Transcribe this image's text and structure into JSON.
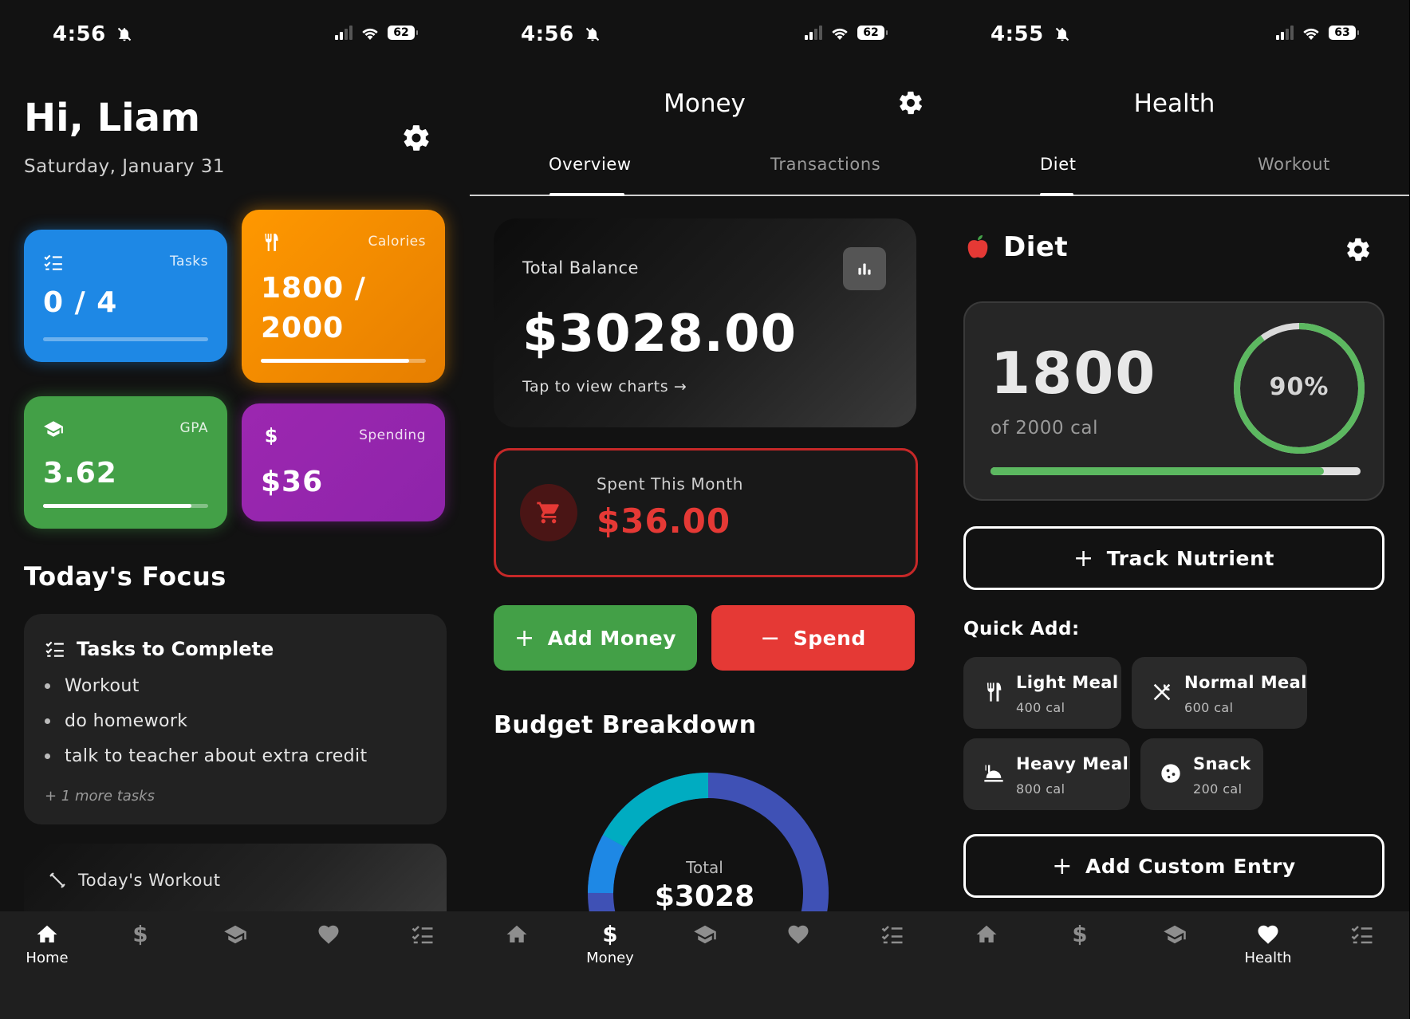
{
  "screens": [
    {
      "status": {
        "time": "4:56",
        "battery": "62"
      },
      "greeting": "Hi, Liam",
      "date": "Saturday, January 31",
      "tiles": [
        {
          "label": "Tasks",
          "value": "0 / 4",
          "progress": 1.0,
          "color": "#1e88e5"
        },
        {
          "label": "Calories",
          "value": "1800 /",
          "value2": "2000",
          "progress": 0.9,
          "color": "#f08a00"
        },
        {
          "label": "GPA",
          "value": "3.62",
          "progress": 0.9,
          "color": "#43a047"
        },
        {
          "label": "Spending",
          "value": "$36",
          "color": "#9c27b0"
        }
      ],
      "focus_title": "Today's Focus",
      "tasks_card": {
        "title": "Tasks to Complete",
        "items": [
          "Workout",
          "do homework",
          "talk to teacher about extra credit"
        ],
        "more": "+ 1 more tasks"
      },
      "workout_card": {
        "title": "Today's Workout"
      },
      "nav_label": "Home"
    },
    {
      "status": {
        "time": "4:56",
        "battery": "62"
      },
      "title": "Money",
      "tabs": [
        "Overview",
        "Transactions"
      ],
      "balance": {
        "label": "Total Balance",
        "value": "$3028.00",
        "hint": "Tap to view charts →"
      },
      "spent": {
        "label": "Spent This Month",
        "value": "$36.00"
      },
      "add_money": "Add Money",
      "spend": "Spend",
      "budget_title": "Budget Breakdown",
      "donut": {
        "label": "Total",
        "value": "$3028"
      },
      "nav_label": "Money"
    },
    {
      "status": {
        "time": "4:55",
        "battery": "63"
      },
      "title": "Health",
      "tabs": [
        "Diet",
        "Workout"
      ],
      "section_title": "Diet",
      "calories": {
        "value": "1800",
        "sub": "of 2000 cal",
        "percent": "90%",
        "progress": 0.9
      },
      "track_btn": "Track Nutrient",
      "quick_add_title": "Quick Add:",
      "meals": [
        {
          "name": "Light Meal",
          "cal": "400 cal",
          "icon": "utensils-icon"
        },
        {
          "name": "Normal Meal",
          "cal": "600 cal",
          "icon": "crossed-utensils-icon"
        },
        {
          "name": "Heavy Meal",
          "cal": "800 cal",
          "icon": "dish-icon"
        },
        {
          "name": "Snack",
          "cal": "200 cal",
          "icon": "cookie-icon"
        }
      ],
      "custom_btn": "Add Custom Entry",
      "nav_label": "Health"
    }
  ],
  "colors": {
    "green": "#43a047",
    "red": "#e53935",
    "dark_red": "#c62828"
  }
}
